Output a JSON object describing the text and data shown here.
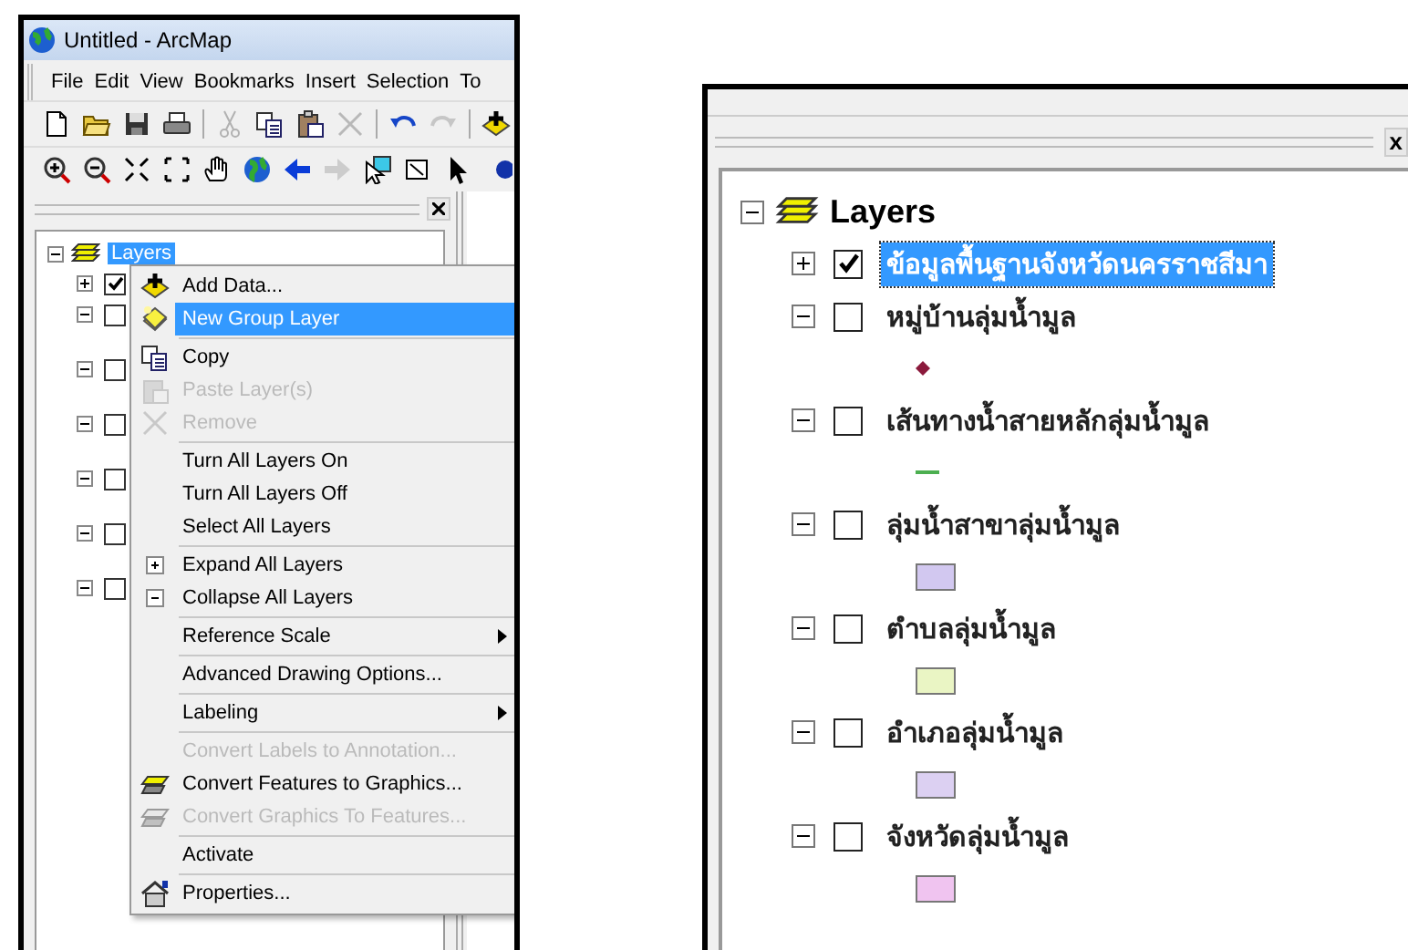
{
  "left_window": {
    "title": "Untitled - ArcMap",
    "menu_bar": [
      "File",
      "Edit",
      "View",
      "Bookmarks",
      "Insert",
      "Selection",
      "To"
    ],
    "toolbars": [
      {
        "buttons": [
          {
            "kind": "new",
            "disabled": false
          },
          {
            "kind": "open",
            "disabled": false
          },
          {
            "kind": "save",
            "disabled": false
          },
          {
            "kind": "print",
            "disabled": false
          },
          {
            "kind": "sep"
          },
          {
            "kind": "cut",
            "disabled": true
          },
          {
            "kind": "copy",
            "disabled": false
          },
          {
            "kind": "paste",
            "disabled": false
          },
          {
            "kind": "delete",
            "disabled": true
          },
          {
            "kind": "sep"
          },
          {
            "kind": "undo",
            "disabled": false
          },
          {
            "kind": "redo",
            "disabled": true
          },
          {
            "kind": "sep"
          },
          {
            "kind": "adddata",
            "disabled": false
          }
        ]
      },
      {
        "buttons": [
          {
            "kind": "zoomin",
            "disabled": false
          },
          {
            "kind": "zoomout",
            "disabled": false
          },
          {
            "kind": "fixedin",
            "disabled": false
          },
          {
            "kind": "fixedout",
            "disabled": false
          },
          {
            "kind": "pan",
            "disabled": false
          },
          {
            "kind": "globe",
            "disabled": false
          },
          {
            "kind": "back",
            "disabled": false
          },
          {
            "kind": "forward",
            "disabled": true
          },
          {
            "kind": "selectel",
            "disabled": false
          },
          {
            "kind": "frame",
            "disabled": false
          },
          {
            "kind": "pointer",
            "disabled": false
          },
          {
            "kind": "dot",
            "disabled": false
          }
        ]
      }
    ],
    "toc": {
      "root": {
        "label": "Layers",
        "selected": true,
        "expanded": true
      },
      "layers": [
        {
          "expanded": false,
          "checked": true
        },
        {
          "expanded": true,
          "checked": false
        },
        {
          "expanded": true,
          "checked": false
        },
        {
          "expanded": true,
          "checked": false
        },
        {
          "expanded": true,
          "checked": false
        },
        {
          "expanded": true,
          "checked": false
        },
        {
          "expanded": true,
          "checked": false
        }
      ]
    },
    "context_menu": [
      {
        "kind": "item",
        "label": "Add Data...",
        "disabled": false,
        "selected": false
      },
      {
        "kind": "item",
        "label": "New Group Layer",
        "disabled": false,
        "selected": true
      },
      {
        "kind": "separator"
      },
      {
        "kind": "item",
        "label": "Copy",
        "disabled": false,
        "selected": false
      },
      {
        "kind": "item",
        "label": "Paste Layer(s)",
        "disabled": true,
        "selected": false
      },
      {
        "kind": "item",
        "label": "Remove",
        "disabled": true,
        "selected": false
      },
      {
        "kind": "separator"
      },
      {
        "kind": "item",
        "label": "Turn All Layers On",
        "disabled": false,
        "selected": false
      },
      {
        "kind": "item",
        "label": "Turn All Layers Off",
        "disabled": false,
        "selected": false
      },
      {
        "kind": "item",
        "label": "Select All Layers",
        "disabled": false,
        "selected": false
      },
      {
        "kind": "separator"
      },
      {
        "kind": "item",
        "label": "Expand All Layers",
        "disabled": false,
        "selected": false
      },
      {
        "kind": "item",
        "label": "Collapse All Layers",
        "disabled": false,
        "selected": false
      },
      {
        "kind": "separator"
      },
      {
        "kind": "submenu",
        "label": "Reference Scale",
        "disabled": false,
        "selected": false
      },
      {
        "kind": "separator"
      },
      {
        "kind": "item",
        "label": "Advanced Drawing Options...",
        "disabled": false,
        "selected": false
      },
      {
        "kind": "separator"
      },
      {
        "kind": "submenu",
        "label": "Labeling",
        "disabled": false,
        "selected": false
      },
      {
        "kind": "separator"
      },
      {
        "kind": "item",
        "label": "Convert Labels to Annotation...",
        "disabled": true,
        "selected": false
      },
      {
        "kind": "item",
        "label": "Convert Features to Graphics...",
        "disabled": false,
        "selected": false
      },
      {
        "kind": "item",
        "label": "Convert Graphics To Features...",
        "disabled": true,
        "selected": false
      },
      {
        "kind": "separator"
      },
      {
        "kind": "item",
        "label": "Activate",
        "disabled": false,
        "selected": false
      },
      {
        "kind": "separator"
      },
      {
        "kind": "item",
        "label": "Properties...",
        "disabled": false,
        "selected": false
      }
    ]
  },
  "right_panel": {
    "close": "x",
    "root": {
      "label": "Layers",
      "expanded": true
    },
    "layers": [
      {
        "name": "ข้อมูลพื้นฐานจังหวัดนครราชสีมา",
        "expanded": false,
        "checked": true,
        "selected": true
      },
      {
        "name": "หมู่บ้านลุ่มน้ำมูล",
        "expanded": true,
        "checked": false,
        "selected": false,
        "legend": {
          "kind": "point",
          "color": "#8b1a3c"
        }
      },
      {
        "name": "เส้นทางน้ำสายหลักลุ่มน้ำมูล",
        "expanded": true,
        "checked": false,
        "selected": false,
        "legend": {
          "kind": "line",
          "color": "#4caf50"
        }
      },
      {
        "name": "ลุ่มน้ำสาขาลุ่มน้ำมูล",
        "expanded": true,
        "checked": false,
        "selected": false,
        "legend": {
          "kind": "fill",
          "color": "#d2c8f0"
        }
      },
      {
        "name": "ตำบลลุ่มน้ำมูล",
        "expanded": true,
        "checked": false,
        "selected": false,
        "legend": {
          "kind": "fill",
          "color": "#eaf5c4"
        }
      },
      {
        "name": "อำเภอลุ่มน้ำมูล",
        "expanded": true,
        "checked": false,
        "selected": false,
        "legend": {
          "kind": "fill",
          "color": "#dcd0f2"
        }
      },
      {
        "name": "จังหวัดลุ่มน้ำมูล",
        "expanded": true,
        "checked": false,
        "selected": false,
        "legend": {
          "kind": "fill",
          "color": "#f0c4f0"
        }
      }
    ]
  }
}
